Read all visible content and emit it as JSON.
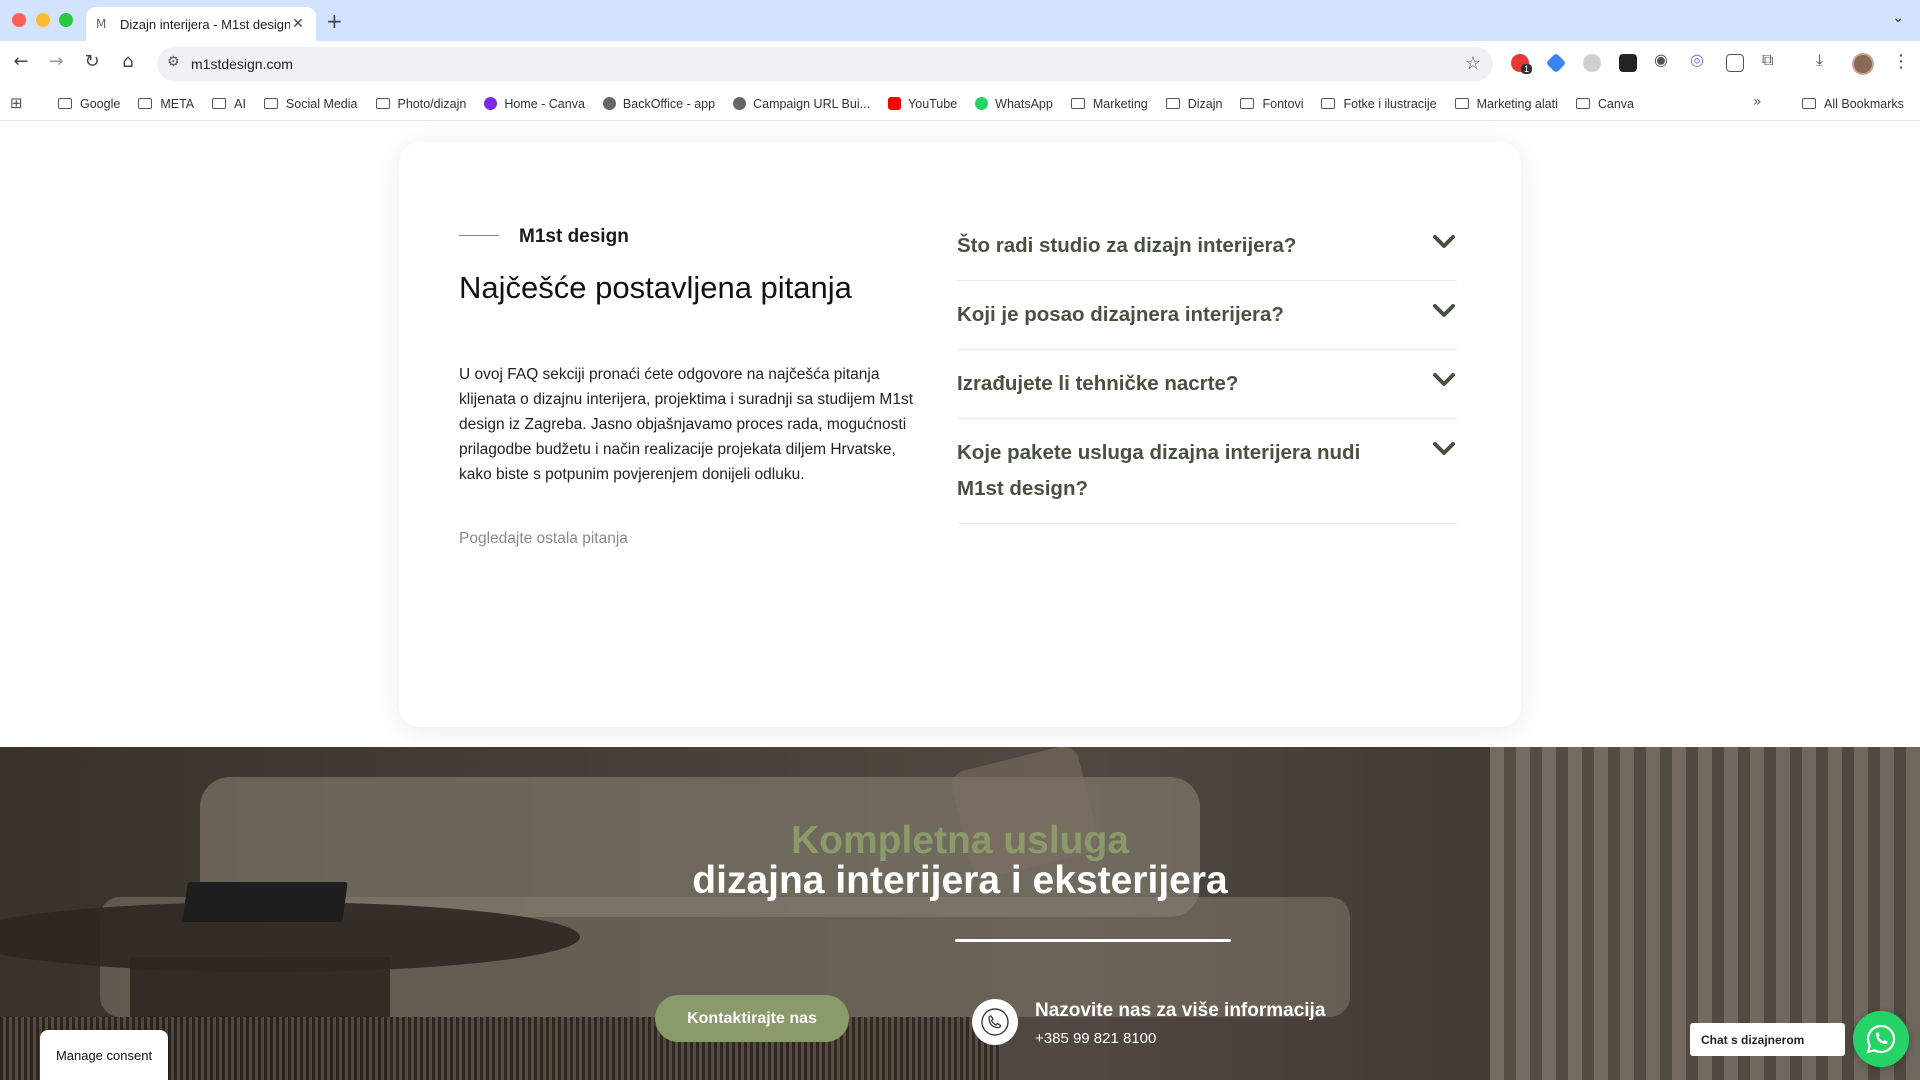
{
  "browser": {
    "tab_title": "Dizajn interijera - M1st design",
    "tab_favicon": "M",
    "url": "m1stdesign.com",
    "extension_badge": "1",
    "bookmarks": [
      {
        "label": "Google",
        "icon": "folder-icon"
      },
      {
        "label": "META",
        "icon": "folder-icon"
      },
      {
        "label": "AI",
        "icon": "folder-icon"
      },
      {
        "label": "Social Media",
        "icon": "folder-icon"
      },
      {
        "label": "Photo/dizajn",
        "icon": "folder-icon"
      },
      {
        "label": "Home - Canva",
        "icon": "canva-icon"
      },
      {
        "label": "BackOffice - app",
        "icon": "globe-icon"
      },
      {
        "label": "Campaign URL Bui...",
        "icon": "globe-icon"
      },
      {
        "label": "YouTube",
        "icon": "youtube-icon"
      },
      {
        "label": "WhatsApp",
        "icon": "whatsapp-icon"
      },
      {
        "label": "Marketing",
        "icon": "folder-icon"
      },
      {
        "label": "Dizajn",
        "icon": "folder-icon"
      },
      {
        "label": "Fontovi",
        "icon": "folder-icon"
      },
      {
        "label": "Fotke i ilustracije",
        "icon": "folder-icon"
      },
      {
        "label": "Marketing alati",
        "icon": "folder-icon"
      },
      {
        "label": "Canva",
        "icon": "folder-icon"
      }
    ],
    "all_bookmarks": "All Bookmarks"
  },
  "faq": {
    "eyebrow": "M1st design",
    "title": "Najčešće postavljena pitanja",
    "description": "U ovoj FAQ sekciji pronaći ćete odgovore na najčešća pitanja klijenata o dizajnu interijera, projektima i suradnji sa studijem M1st design iz Zagreba. Jasno objašnjavamo proces rada, mogućnosti prilagodbe budžetu i način realizacije projekata diljem Hrvatske, kako biste s potpunim povjerenjem donijeli odluku.",
    "more_link": "Pogledajte ostala pitanja",
    "questions": [
      "Što radi studio za dizajn interijera?",
      "Koji je posao dizajnera interijera?",
      "Izrađujete li tehničke nacrte?",
      "Koje pakete usluga dizajna interijera nudi M1st design?"
    ]
  },
  "hero": {
    "accent_line": "Kompletna usluga",
    "main_line": "dizajna interijera i eksterijera",
    "cta_label": "Kontaktirajte nas",
    "phone_title": "Nazovite nas za više informacija",
    "phone_number": "+385 99 821 8100"
  },
  "widgets": {
    "consent_label": "Manage consent",
    "chat_label": "Chat s dizajnerom"
  },
  "colors": {
    "accent_green": "#8b9a6a",
    "question_text": "#4a5140",
    "whatsapp": "#25d366",
    "tab_bar": "#d3e3fd"
  }
}
